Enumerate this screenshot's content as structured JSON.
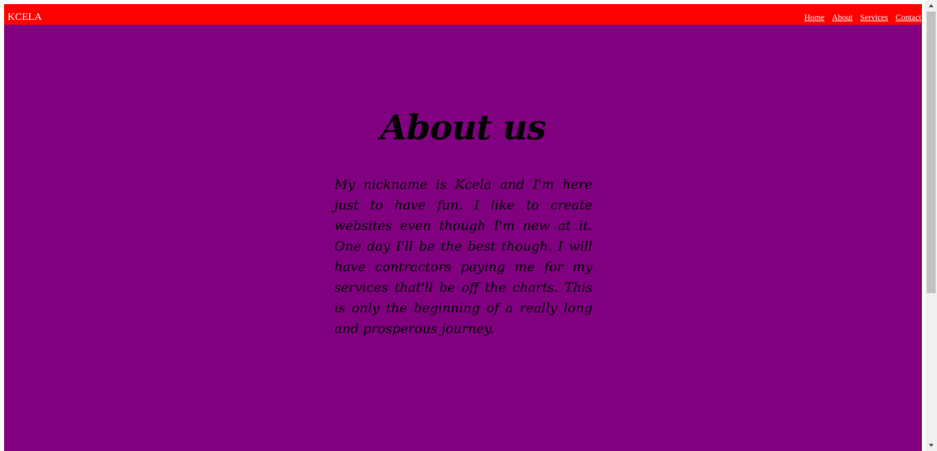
{
  "navbar": {
    "brand": "KCELA",
    "links": [
      "Home",
      "About",
      "Services",
      "Contact"
    ]
  },
  "main": {
    "heading": "About us",
    "paragraph": "My nickname is Kcela and I'm here just to have fun. I like to create websites even though I'm new at it. One day I'll be the best though. I will have contractors paying me for my services that'll be off the charts. This is only the beginning of a really long and prosperous journey."
  },
  "colors": {
    "navbar_bg": "#ff0000",
    "page_bg": "#800080",
    "text": "#000000",
    "nav_text": "#ffffff"
  },
  "icons": {
    "scroll_up": "triangle-up",
    "scroll_down": "triangle-down"
  }
}
